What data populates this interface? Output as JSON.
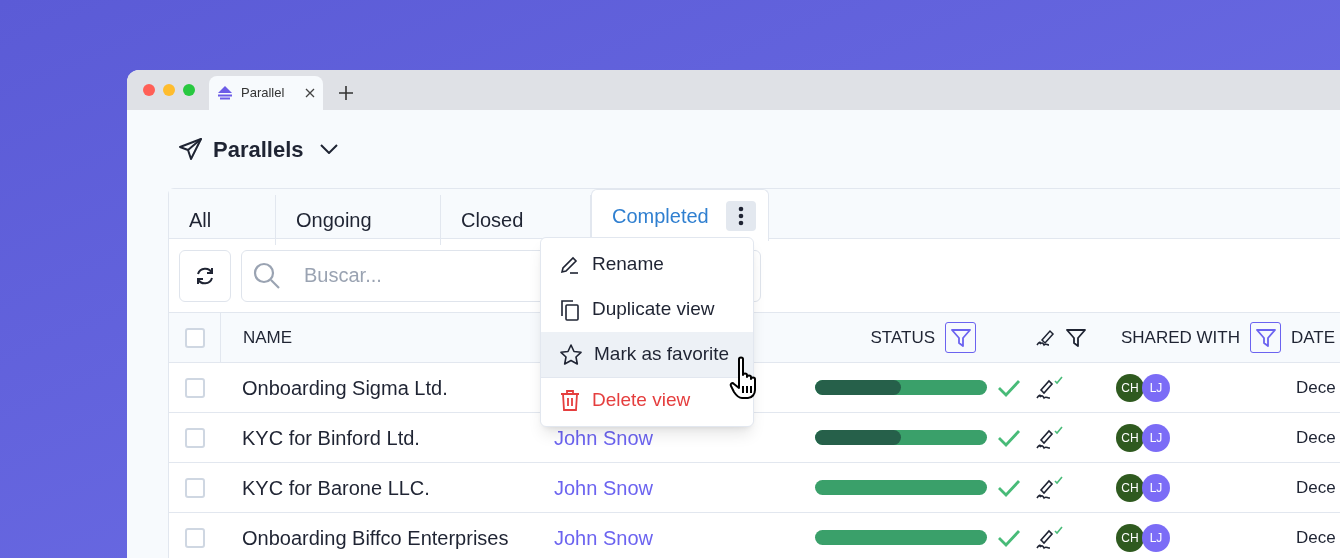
{
  "browser": {
    "tab_title": "Parallel"
  },
  "page": {
    "title": "Parallels"
  },
  "view_tabs": [
    {
      "label": "All",
      "selected": false
    },
    {
      "label": "Ongoing",
      "selected": false
    },
    {
      "label": "Closed",
      "selected": false
    },
    {
      "label": "Completed",
      "selected": true
    }
  ],
  "menu": [
    {
      "label": "Rename",
      "kind": "rename",
      "highlighted": false
    },
    {
      "label": "Duplicate view",
      "kind": "duplicate",
      "highlighted": false
    },
    {
      "label": "Mark as favorite",
      "kind": "favorite",
      "highlighted": true
    },
    {
      "label": "Delete view",
      "kind": "delete",
      "highlighted": false
    }
  ],
  "search": {
    "placeholder": "Buscar..."
  },
  "table": {
    "all_checked": false,
    "columns": [
      {
        "kind": "text",
        "label": "NAME"
      },
      {
        "kind": "text",
        "label": "STATUS",
        "filter_active": true
      },
      {
        "kind": "signature",
        "filter_active": false
      },
      {
        "kind": "text",
        "label": "SHARED WITH",
        "filter_active": true
      },
      {
        "kind": "text",
        "label": "DATE"
      }
    ],
    "rows": [
      {
        "checked": false,
        "name": "Onboarding Sigma Ltd.",
        "level": 0.5,
        "shared": [
          {
            "initials": "CH",
            "color": "#2f5a1f"
          },
          {
            "initials": "LJ",
            "color": "#7b6cf6"
          }
        ],
        "date": "Dece"
      },
      {
        "checked": false,
        "name": "KYC for Binford Ltd.",
        "owner": "John Snow",
        "level": 0.5,
        "shared": [
          {
            "initials": "CH",
            "color": "#2f5a1f"
          },
          {
            "initials": "LJ",
            "color": "#7b6cf6"
          }
        ],
        "date": "Dece"
      },
      {
        "checked": false,
        "name": "KYC for Barone LLC.",
        "owner": "John Snow",
        "level": 0,
        "shared": [
          {
            "initials": "CH",
            "color": "#2f5a1f"
          },
          {
            "initials": "LJ",
            "color": "#7b6cf6"
          }
        ],
        "date": "Dece"
      },
      {
        "checked": false,
        "name": "Onboarding Biffco Enterprises",
        "owner": "John Snow",
        "level": 0,
        "shared": [
          {
            "initials": "CH",
            "color": "#2f5a1f"
          },
          {
            "initials": "LJ",
            "color": "#7b6cf6"
          }
        ],
        "date": "Dece"
      }
    ]
  }
}
